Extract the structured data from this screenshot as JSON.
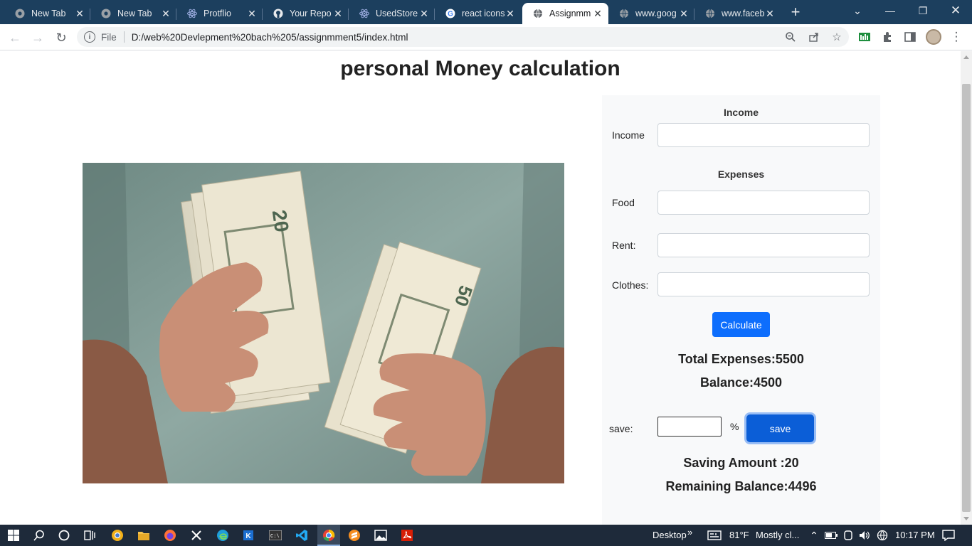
{
  "browser": {
    "tabs": [
      {
        "title": "New Tab",
        "icon": "chrome-icon"
      },
      {
        "title": "New Tab",
        "icon": "chrome-icon"
      },
      {
        "title": "Protflio",
        "icon": "react-icon"
      },
      {
        "title": "Your Repo",
        "icon": "github-icon"
      },
      {
        "title": "UsedStore",
        "icon": "react-icon"
      },
      {
        "title": "react icons",
        "icon": "google-icon"
      },
      {
        "title": "Assignmm",
        "icon": "globe-icon"
      },
      {
        "title": "www.goog",
        "icon": "globe-icon"
      },
      {
        "title": "www.faceb",
        "icon": "globe-icon"
      }
    ],
    "active_tab_index": 6,
    "address": {
      "scheme_label": "File",
      "url": "D:/web%20Devlepment%20bach%205/assignmment5/index.html"
    }
  },
  "page": {
    "title": "personal Money calculation",
    "image_alt": "hands holding dollar bills",
    "income_section": {
      "heading": "Income",
      "income_label": "Income",
      "income_value": ""
    },
    "expenses_section": {
      "heading": "Expenses",
      "food_label": "Food",
      "food_value": "",
      "rent_label": "Rent:",
      "rent_value": "",
      "clothes_label": "Clothes:",
      "clothes_value": ""
    },
    "calculate_label": "Calculate",
    "total_expenses": "Total Expenses:5500",
    "balance": "Balance:4500",
    "save_section": {
      "label": "save:",
      "value": "",
      "percent_sign": "%",
      "button_label": "save"
    },
    "saving_amount": "Saving Amount :20",
    "remaining_balance": "Remaining Balance:4496",
    "colors": {
      "primary_button": "#0d6efd",
      "panel_bg": "#f8f9fa"
    }
  },
  "taskbar": {
    "desktop_label": "Desktop",
    "weather_temp": "81°F",
    "weather_desc": "Mostly cl...",
    "time": "10:17 PM"
  }
}
